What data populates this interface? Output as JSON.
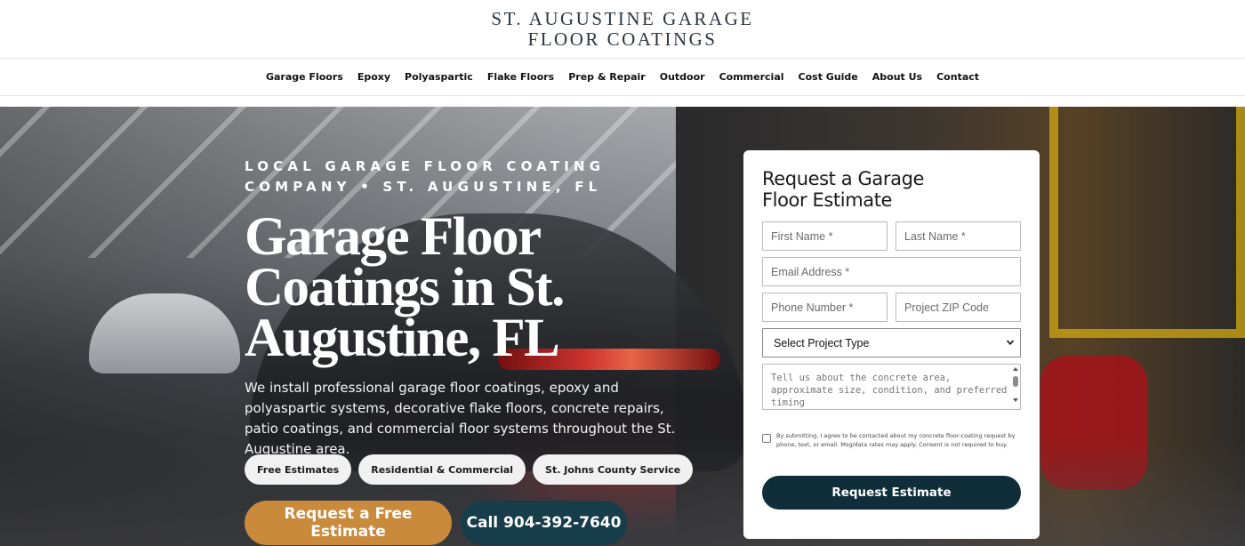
{
  "header": {
    "logo_line1": "ST. AUGUSTINE GARAGE",
    "logo_line2": "FLOOR COATINGS"
  },
  "nav": {
    "items": [
      "Garage Floors",
      "Epoxy",
      "Polyaspartic",
      "Flake Floors",
      "Prep & Repair",
      "Outdoor",
      "Commercial",
      "Cost Guide",
      "About Us",
      "Contact"
    ]
  },
  "hero": {
    "eyebrow": "LOCAL GARAGE FLOOR COATING COMPANY • ST. AUGUSTINE, FL",
    "title_line1": "Garage Floor",
    "title_line2": "Coatings in St.",
    "title_line3": "Augustine, FL",
    "description": "We install professional garage floor coatings, epoxy and polyaspartic systems, decorative flake floors, concrete repairs, patio coatings, and commercial floor systems throughout the St. Augustine area.",
    "pills": [
      "Free Estimates",
      "Residential & Commercial",
      "St. Johns County Service"
    ],
    "cta_primary": "Request a Free Estimate",
    "cta_secondary": "Call 904-392-7640"
  },
  "form": {
    "title": "Request a Garage Floor Estimate",
    "first_name_placeholder": "First Name *",
    "last_name_placeholder": "Last Name *",
    "email_placeholder": "Email Address *",
    "phone_placeholder": "Phone Number *",
    "zip_placeholder": "Project ZIP Code",
    "project_type_selected": "Select Project Type",
    "message_placeholder": "Tell us about the concrete area, approximate size, condition, and preferred timing",
    "consent_text": "By submitting, I agree to be contacted about my concrete floor-coating request by phone, text, or email. Msg/data rates may apply. Consent is not required to buy.",
    "submit_label": "Request Estimate"
  },
  "colors": {
    "cta_primary": "#c98a3b",
    "cta_secondary": "#183d4a",
    "submit": "#0f2e3a",
    "logo": "#2b3640"
  },
  "icons": {
    "select": "chevron-down-icon"
  }
}
